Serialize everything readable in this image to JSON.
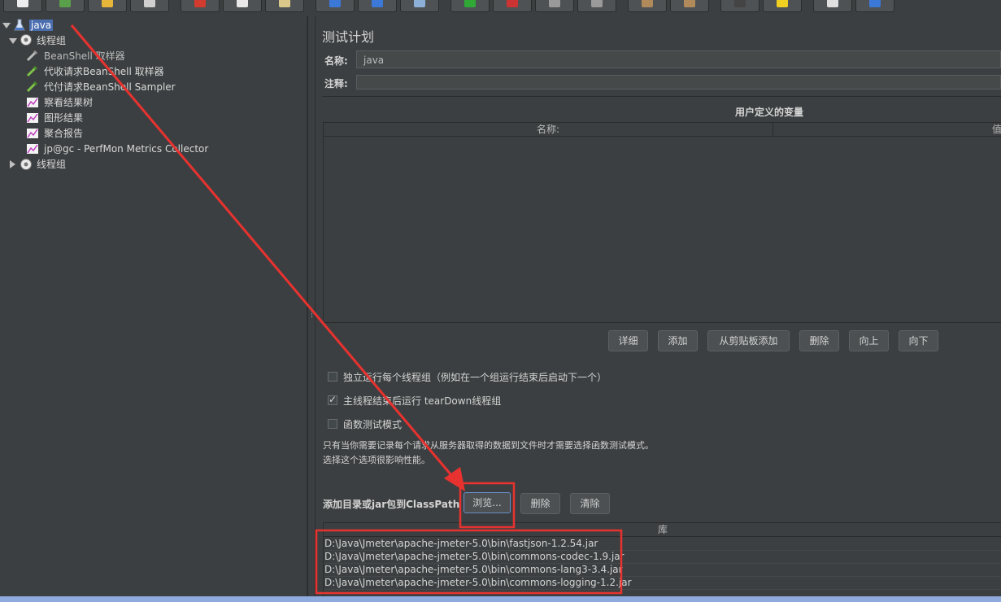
{
  "tree": {
    "root": "java",
    "group1": "线程组",
    "items": [
      "BeanShell 取样器",
      "代收请求BeanShell 取样器",
      "代付请求BeanShell Sampler",
      "察看结果树",
      "图形结果",
      "聚合报告",
      "jp@gc - PerfMon Metrics Collector"
    ],
    "group2": "线程组"
  },
  "panel": {
    "title": "测试计划",
    "name_label": "名称:",
    "name_value": "java",
    "comment_label": "注释:",
    "vars_title": "用户定义的变量",
    "vars_col_name": "名称:",
    "vars_col_value": "值",
    "buttons": [
      "详细",
      "添加",
      "从剪贴板添加",
      "删除",
      "向上",
      "向下"
    ],
    "opt1": "独立运行每个线程组（例如在一个组运行结束后启动下一个）",
    "opt1_checked": false,
    "opt2": "主线程结束后运行 tearDown线程组",
    "opt2_checked": true,
    "opt3": "函数测试模式",
    "opt3_checked": false,
    "note1": "只有当你需要记录每个请求从服务器取得的数据到文件时才需要选择函数测试模式。",
    "note2": "选择这个选项很影响性能。",
    "classpath_label": "添加目录或jar包到ClassPath",
    "browse": "浏览...",
    "delete": "删除",
    "clear": "清除",
    "lib_header": "库",
    "libs": [
      "D:\\Java\\Jmeter\\apache-jmeter-5.0\\bin\\fastjson-1.2.54.jar",
      "D:\\Java\\Jmeter\\apache-jmeter-5.0\\bin\\commons-codec-1.9.jar",
      "D:\\Java\\Jmeter\\apache-jmeter-5.0\\bin\\commons-lang3-3.4.jar",
      "D:\\Java\\Jmeter\\apache-jmeter-5.0\\bin\\commons-logging-1.2.jar"
    ]
  },
  "colors": {
    "background": "#3c3f41",
    "selection": "#4b6eaf",
    "annotation": "#e8322f"
  }
}
